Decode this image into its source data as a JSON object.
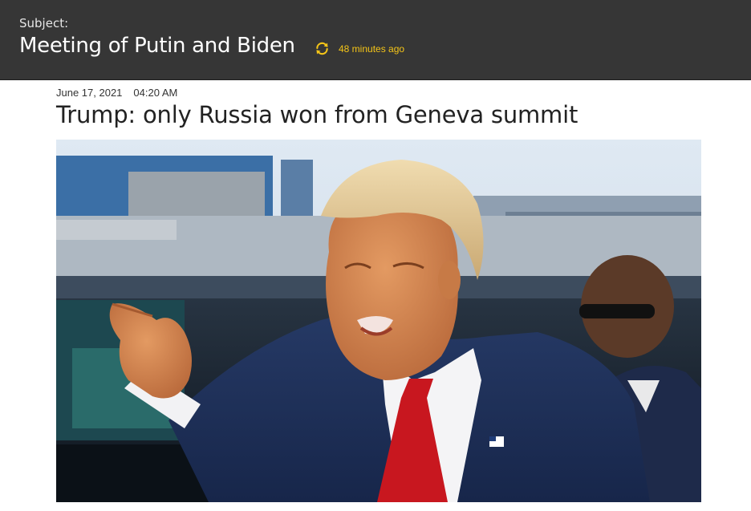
{
  "header": {
    "subject_label": "Subject:",
    "subject_title": "Meeting of Putin and Biden",
    "update_icon": "refresh-icon",
    "updated_text": "48 minutes ago",
    "accent_color": "#f5c518"
  },
  "article": {
    "date": "June 17, 2021",
    "time": "04:20 AM",
    "headline": "Trump: only Russia won from Geneva summit"
  }
}
